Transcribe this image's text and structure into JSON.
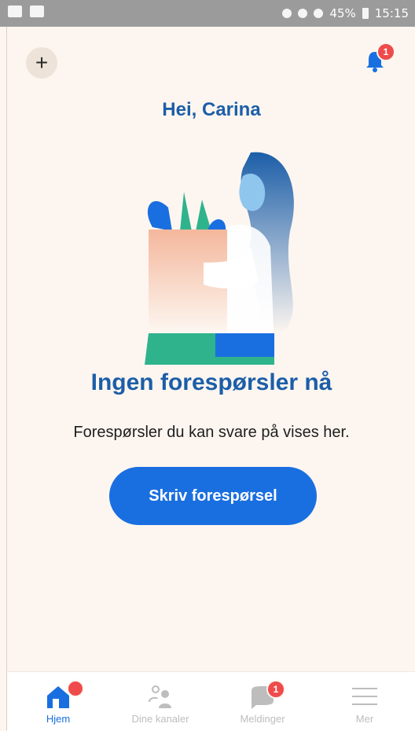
{
  "statusbar": {
    "battery": "45%",
    "time": "15:15"
  },
  "header": {
    "greeting": "Hei, Carina",
    "notification_count": "1"
  },
  "empty_state": {
    "title": "Ingen forespørsler nå",
    "text": "Forespørsler du kan svare på vises her.",
    "button_label": "Skriv forespørsel"
  },
  "tabs": [
    {
      "label": "Hjem",
      "badge": ""
    },
    {
      "label": "Dine kanaler",
      "badge": ""
    },
    {
      "label": "Meldinger",
      "badge": "1"
    },
    {
      "label": "Mer",
      "badge": ""
    }
  ],
  "colors": {
    "accent": "#1a6fe0",
    "title": "#1c5ea8",
    "badge": "#ef4b4b",
    "background": "#fdf6f0"
  }
}
